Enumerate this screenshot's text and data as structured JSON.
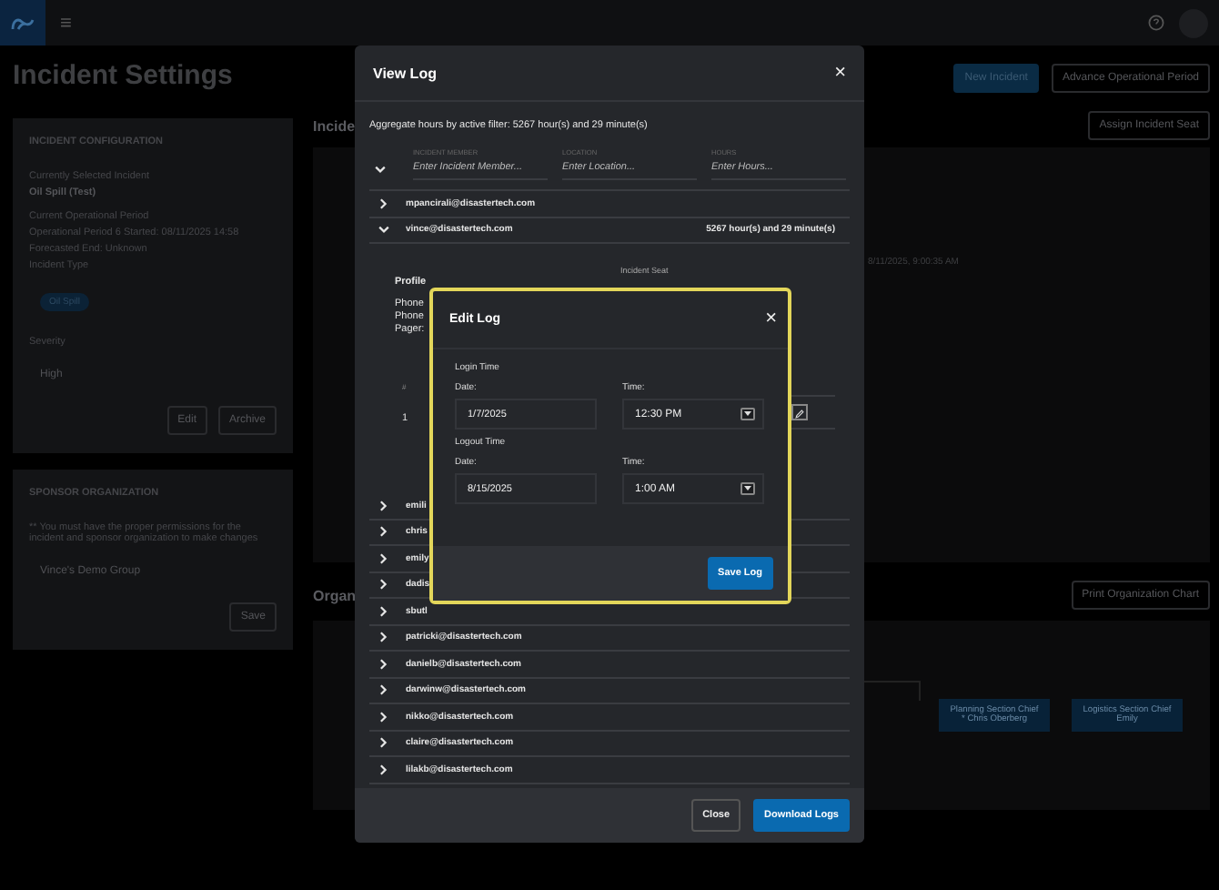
{
  "app_bar": {
    "menu_glyph": "≡"
  },
  "close_glyph": "×",
  "page": {
    "title": "Incident Settings",
    "actions": [
      {
        "label": "New Incident",
        "kind": "primary"
      },
      {
        "label": "Advance Operational Period",
        "kind": "outline"
      }
    ],
    "incident_configuration": {
      "heading": "INCIDENT CONFIGURATION",
      "selected_label": "Currently Selected Incident",
      "selected_value": "Oil Spill (Test)",
      "period_label": "Current Operational Period",
      "period_value": "Operational Period 6 Started: 08/11/2025 14:58",
      "forecast": "Forecasted End: Unknown",
      "type_label": "Incident Type",
      "type_chip": "Oil Spill",
      "severity_label": "Severity",
      "severity_value": "High",
      "buttons": [
        "Edit",
        "Archive"
      ]
    },
    "sponsor_organization": {
      "heading": "SPONSOR ORGANIZATION",
      "note": "** You must have the proper permissions for the incident and sponsor organization to make changes",
      "organization": "Vince's Demo Group",
      "button": "Save"
    },
    "incident_section": {
      "title": "Incide",
      "button": "Assign Incident Seat",
      "timestamp": "8/11/2025, 9:00:35 AM"
    },
    "org_section": {
      "title": "Organ",
      "button": "Print Organization Chart",
      "nodes": [
        {
          "title": "Planning Section Chief",
          "subtitle": "* Chris Oberberg"
        },
        {
          "title": "Logistics Section Chief",
          "subtitle": "Emily"
        }
      ]
    }
  },
  "view_log": {
    "title": "View Log",
    "aggregate": "Aggregate hours by active filter: 5267 hour(s) and 29 minute(s)",
    "filters": [
      {
        "label": "INCIDENT MEMBER",
        "placeholder": "Enter Incident Member..."
      },
      {
        "label": "LOCATION",
        "placeholder": "Enter Location..."
      },
      {
        "label": "HOURS",
        "placeholder": "Enter Hours..."
      }
    ],
    "members": [
      {
        "email": "mpancirali@disastertech.com",
        "expanded": false
      },
      {
        "email": "vince@disastertech.com",
        "expanded": true,
        "hours": "5267 hour(s) and 29 minute(s)"
      },
      {
        "email": "emili",
        "expanded": false
      },
      {
        "email": "chris",
        "expanded": false
      },
      {
        "email": "emily",
        "expanded": false
      },
      {
        "email": "dadis",
        "expanded": false
      },
      {
        "email": "sbutl",
        "expanded": false
      },
      {
        "email": "patricki@disastertech.com",
        "expanded": false
      },
      {
        "email": "danielb@disastertech.com",
        "expanded": false
      },
      {
        "email": "darwinw@disastertech.com",
        "expanded": false
      },
      {
        "email": "nikko@disastertech.com",
        "expanded": false
      },
      {
        "email": "claire@disastertech.com",
        "expanded": false
      },
      {
        "email": "lilakb@disastertech.com",
        "expanded": false
      }
    ],
    "profile": {
      "heading": "Profile",
      "lines": [
        "Phone",
        "Phone",
        "Pager:"
      ],
      "seat_heading": "Incident Seat",
      "table_header": "#",
      "table_row": "1"
    },
    "buttons": [
      {
        "label": "Close",
        "kind": "outline"
      },
      {
        "label": "Download Logs",
        "kind": "primary"
      }
    ]
  },
  "edit_log": {
    "title": "Edit Log",
    "sections": [
      {
        "heading": "Login Time",
        "date_label": "Date:",
        "date": "1/7/2025",
        "time_label": "Time:",
        "time": "12:30 PM"
      },
      {
        "heading": "Logout Time",
        "date_label": "Date:",
        "date": "8/15/2025",
        "time_label": "Time:",
        "time": "1:00 AM"
      }
    ],
    "button": "Save Log"
  }
}
